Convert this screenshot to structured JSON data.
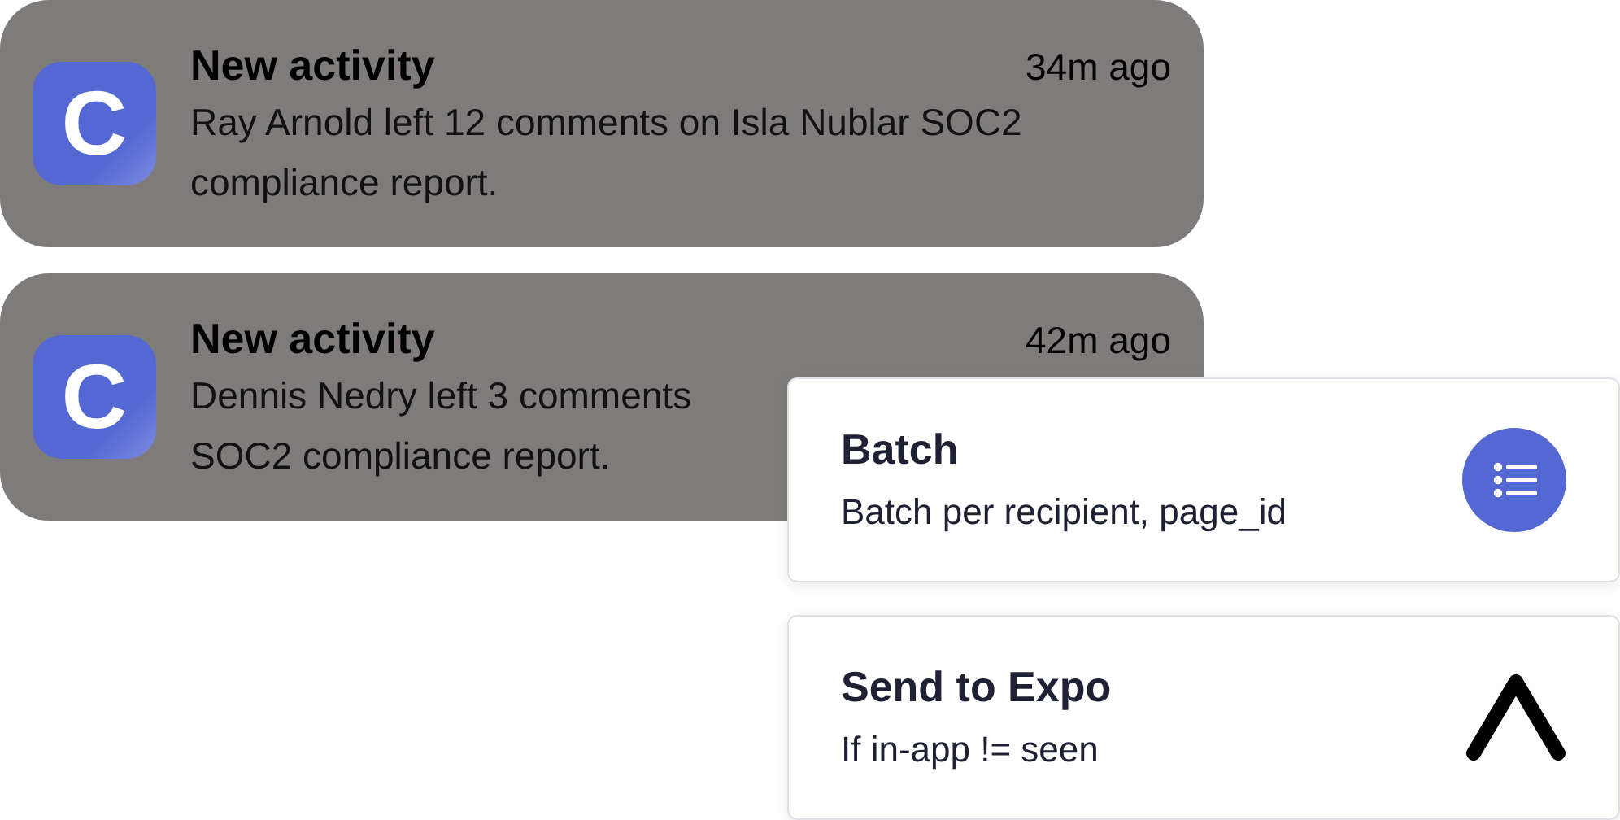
{
  "notifications": [
    {
      "logo_letter": "C",
      "title": "New activity",
      "time": "34m ago",
      "lines": [
        "Ray Arnold left 12 comments on Isla Nublar SOC2",
        "compliance report."
      ]
    },
    {
      "logo_letter": "C",
      "title": "New activity",
      "time": "42m ago",
      "lines": [
        "Dennis Nedry left 3 comments",
        "SOC2 compliance report."
      ]
    }
  ],
  "steps": [
    {
      "kind": "batch",
      "title": "Batch",
      "subtitle": "Batch per recipient, page_id"
    },
    {
      "kind": "expo",
      "title": "Send to Expo",
      "subtitle": "If in-app != seen"
    }
  ]
}
